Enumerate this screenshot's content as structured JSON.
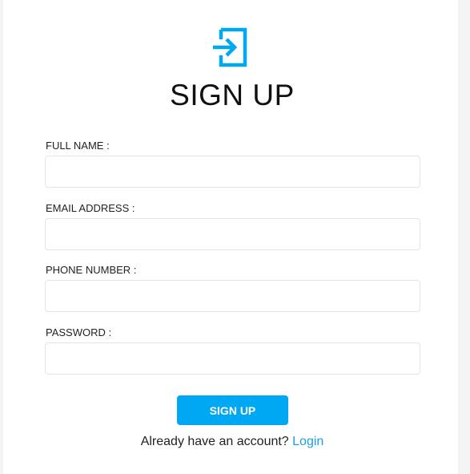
{
  "app": {
    "title": "SIGN UP",
    "icon": "sign-in-icon",
    "accent_color": "#00a8f3"
  },
  "form": {
    "fields": [
      {
        "label": "FULL NAME :",
        "value": "",
        "placeholder": ""
      },
      {
        "label": "EMAIL ADDRESS :",
        "value": "",
        "placeholder": ""
      },
      {
        "label": "PHONE NUMBER :",
        "value": "",
        "placeholder": ""
      },
      {
        "label": "PASSWORD :",
        "value": "",
        "placeholder": ""
      }
    ],
    "submit_label": "SIGN UP"
  },
  "footer": {
    "prompt": "Already have an account? ",
    "link_label": "Login"
  }
}
